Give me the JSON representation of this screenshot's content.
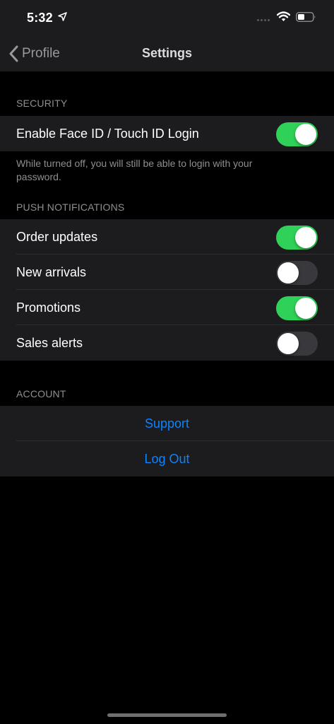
{
  "status_bar": {
    "time": "5:32",
    "icons": [
      "location-arrow-icon",
      "signal-dots-icon",
      "wifi-icon",
      "battery-icon"
    ]
  },
  "nav": {
    "back_label": "Profile",
    "title": "Settings"
  },
  "security": {
    "header": "SECURITY",
    "items": [
      {
        "label": "Enable Face ID / Touch ID Login",
        "enabled": true
      }
    ],
    "footer": "While turned off, you will still be able to login with your password."
  },
  "push": {
    "header": "PUSH NOTIFICATIONS",
    "items": [
      {
        "label": "Order updates",
        "enabled": true
      },
      {
        "label": "New arrivals",
        "enabled": false
      },
      {
        "label": "Promotions",
        "enabled": true
      },
      {
        "label": "Sales alerts",
        "enabled": false
      }
    ]
  },
  "account": {
    "header": "ACCOUNT",
    "items": [
      {
        "label": "Support"
      },
      {
        "label": "Log Out"
      }
    ]
  },
  "colors": {
    "background": "#000000",
    "cell": "#1c1c1e",
    "toggle_on": "#30d158",
    "toggle_off": "#39393d",
    "link": "#0a84ff",
    "secondary_text": "#8e8e93"
  }
}
